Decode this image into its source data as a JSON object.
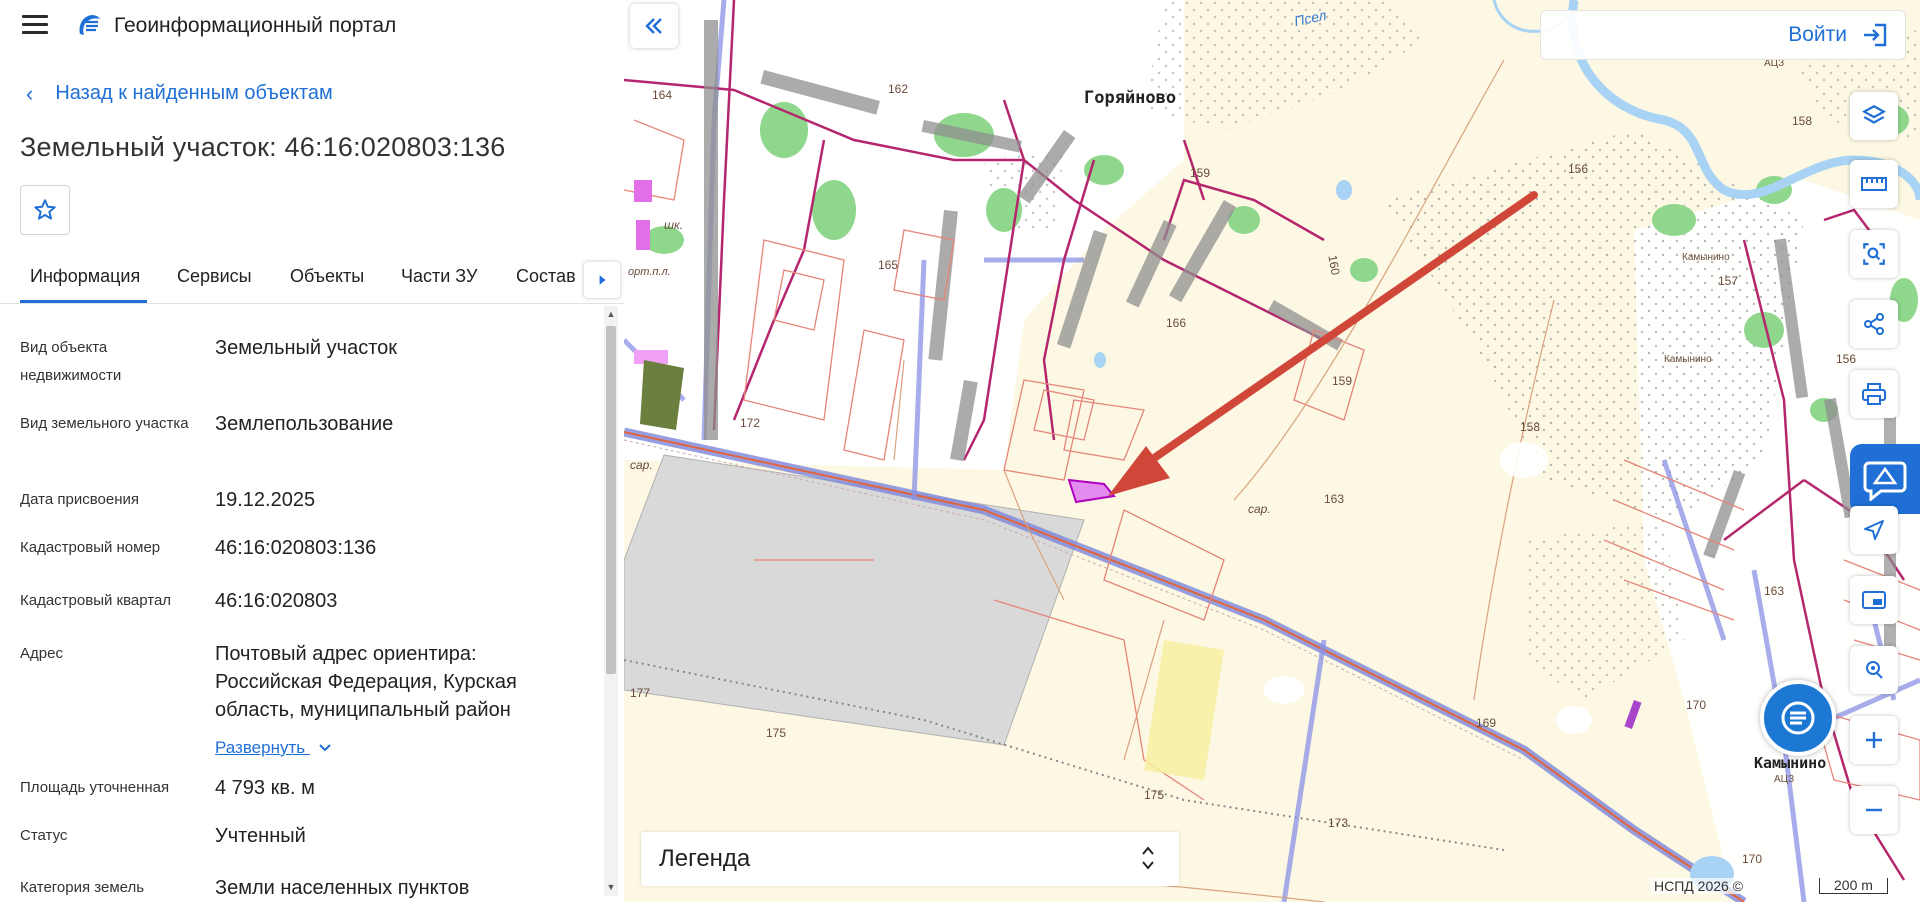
{
  "header": {
    "app_title": "Геоинформационный портал"
  },
  "nav": {
    "back_label": "Назад к найденным объектам"
  },
  "object": {
    "title": "Земельный участок: 46:16:020803:136"
  },
  "tabs": [
    {
      "label": "Информация"
    },
    {
      "label": "Сервисы"
    },
    {
      "label": "Объекты"
    },
    {
      "label": "Части ЗУ"
    },
    {
      "label": "Состав"
    }
  ],
  "fields": [
    {
      "label": "Вид объекта недвижимости",
      "value": "Земельный участок"
    },
    {
      "label": "Вид земельного участка",
      "value": "Землепользование"
    },
    {
      "label": "Дата присвоения",
      "value": "19.12.2025"
    },
    {
      "label": "Кадастровый номер",
      "value": "46:16:020803:136"
    },
    {
      "label": "Кадастровый квартал",
      "value": "46:16:020803"
    },
    {
      "label": "Адрес",
      "value": "Почтовый адрес ориентира: Российская Федерация, Курская область, муниципальный район"
    },
    {
      "label": "Площадь уточненная",
      "value": "4 793 кв. м"
    },
    {
      "label": "Статус",
      "value": "Учтенный"
    },
    {
      "label": "Категория земель",
      "value": "Земли населенных пунктов"
    }
  ],
  "expand_label": "Развернуть",
  "map": {
    "login_label": "Войти",
    "legend_label": "Легенда",
    "copyright": "НСПД 2026 ©",
    "scale_label": "200 m",
    "places": {
      "goryainovo": "Горяйново",
      "kamynino": "Камынино",
      "river": "Псел",
      "kamynino_small": "Камынино",
      "kamynino_small2": "Камынино",
      "school": "шк.",
      "ort": "орт.п.л.",
      "sar1": "сар.",
      "sar2": "сар.",
      "acz1": "АЦЗ",
      "acz2": "АЦЗ"
    },
    "heights": [
      "164",
      "162",
      "156",
      "158",
      "159",
      "159",
      "157",
      "156",
      "165",
      "166",
      "160",
      "172",
      "158",
      "163",
      "163",
      "170",
      "169",
      "170",
      "175",
      "175",
      "173",
      "177"
    ]
  },
  "colors": {
    "accent": "#1f6fd6",
    "parcel_highlight": "#d24be0",
    "arrow": "#d0473a"
  }
}
